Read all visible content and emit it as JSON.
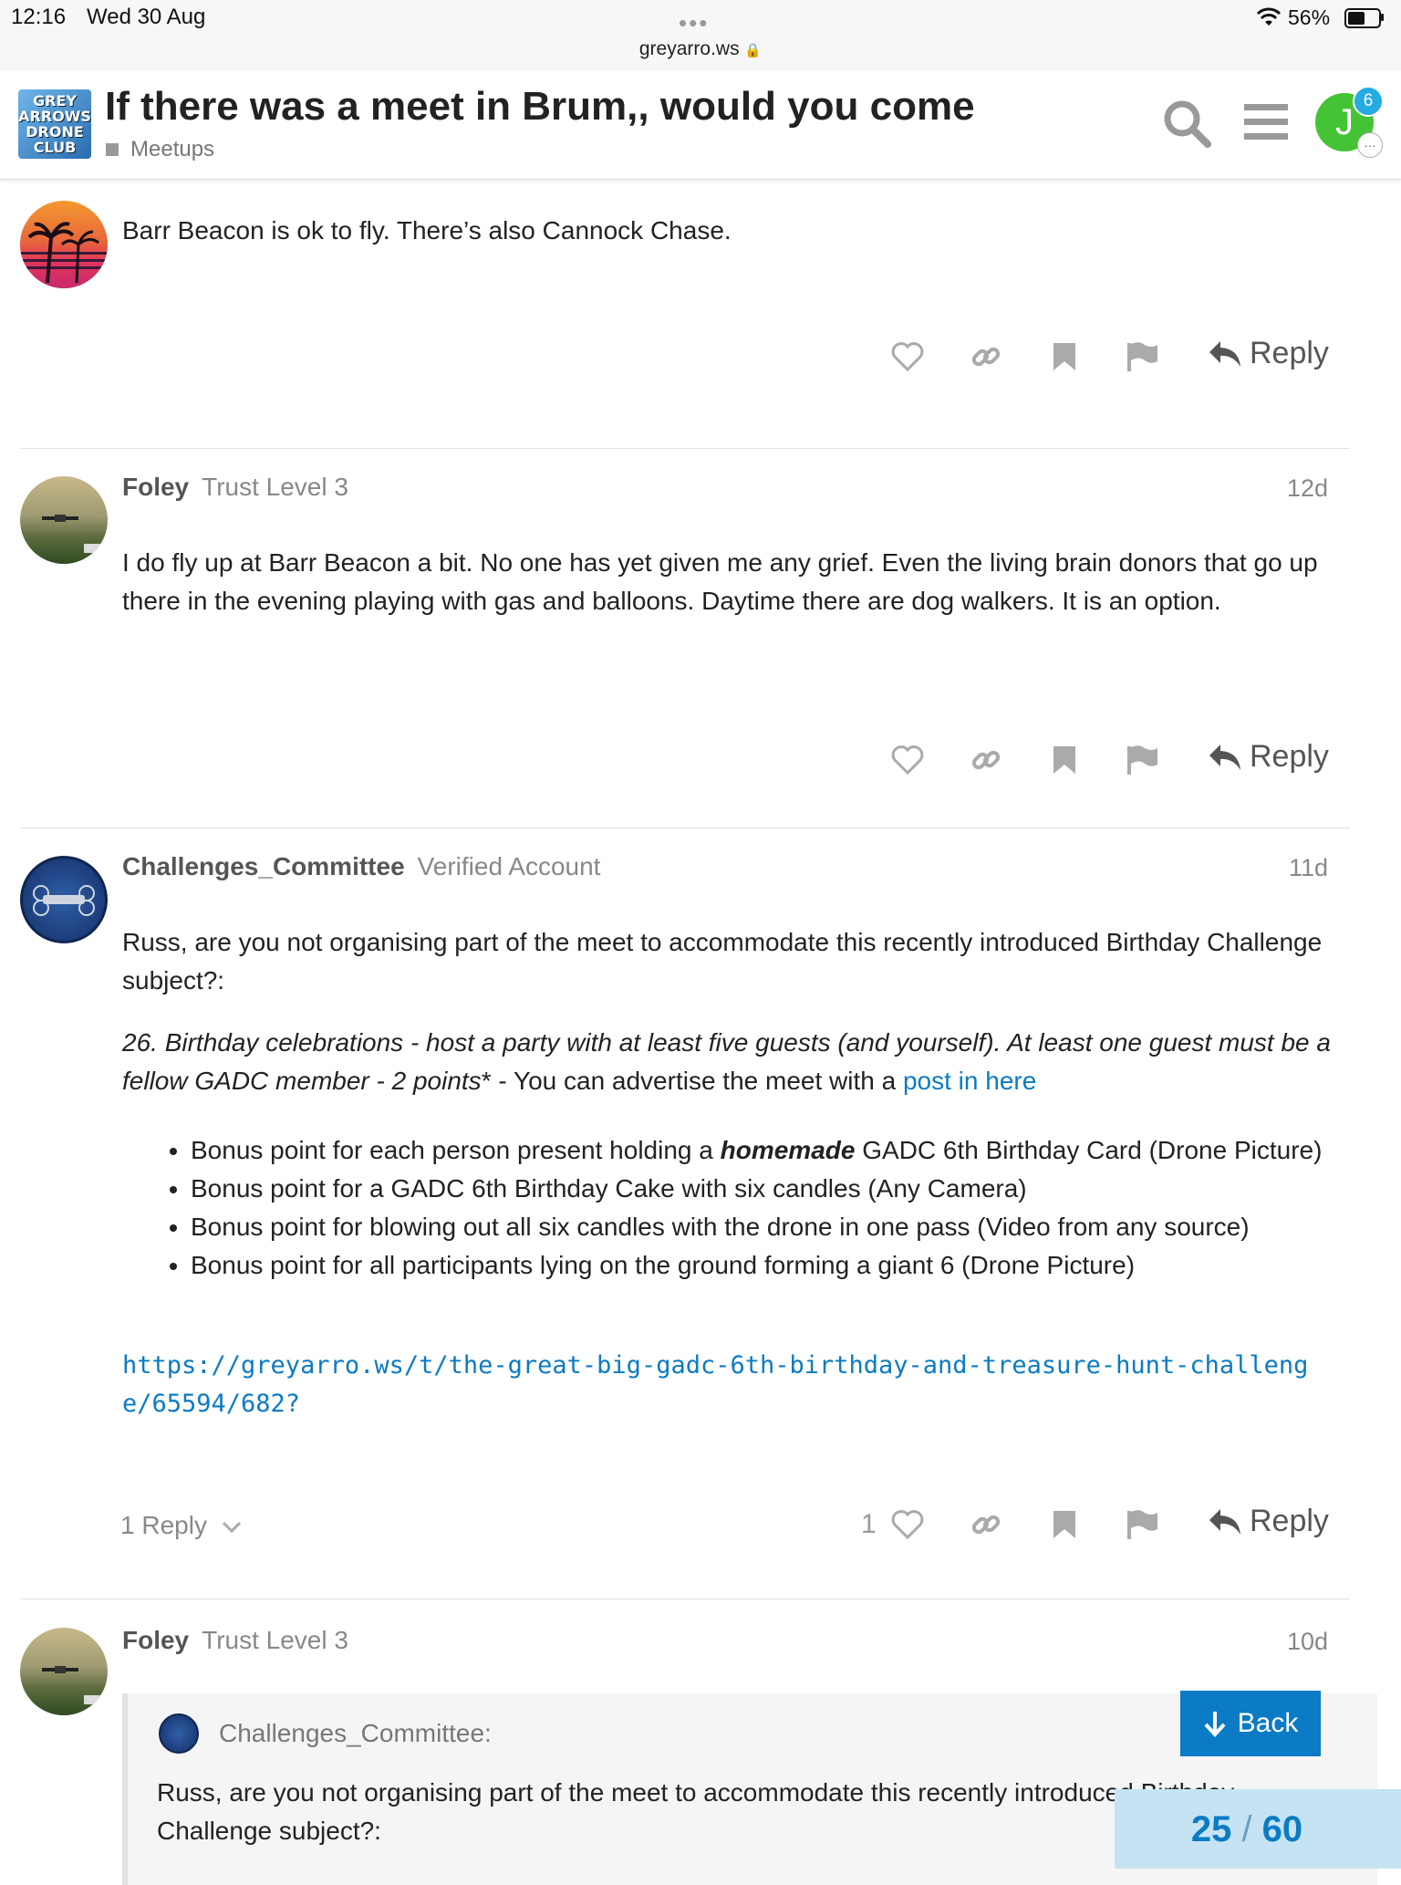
{
  "status_bar": {
    "time": "12:16",
    "date": "Wed 30 Aug",
    "url": "greyarro.ws",
    "battery": "56%"
  },
  "header": {
    "logo_text": [
      "GREY",
      "ARROWS",
      "DRONE",
      "CLUB"
    ],
    "title": "If there was a meet in Brum,, would you come",
    "category": "Meetups",
    "notification_count": "6",
    "avatar_letter": "J"
  },
  "posts": [
    {
      "text": "Barr Beacon is ok to fly. There’s also Cannock Chase.",
      "reply_label": "Reply"
    },
    {
      "username": "Foley",
      "user_title": "Trust Level 3",
      "date": "12d",
      "text": "I do fly up at Barr Beacon a bit. No one has yet given me any grief. Even the living brain donors that go up there in the evening playing with gas and balloons. Daytime there are dog walkers. It is an option.",
      "reply_label": "Reply"
    },
    {
      "username": "Challenges_Committee",
      "user_title": "Verified Account",
      "date": "11d",
      "intro": "Russ, are you not organising part of the meet to accommodate this recently introduced Birthday Challenge subject?:",
      "quote_italic": "26. Birthday celebrations - host a party with at least five guests (and yourself). At least one guest must be a fellow GADC member - 2 points",
      "quote_rest": "* - You can advertise the meet with a ",
      "quote_link": "post in here",
      "bullet1_pre": "Bonus point for each person present holding a ",
      "bullet1_bold": "homemade",
      "bullet1_post": " GADC 6th Birthday Card (Drone Picture)",
      "bullet2": "Bonus point for a GADC 6th Birthday Cake with six candles (Any Camera)",
      "bullet3": "Bonus point for blowing out all six candles with the drone in one pass (Video from any source)",
      "bullet4": "Bonus point for all participants lying on the ground forming a giant 6 (Drone Picture)",
      "url": "https://greyarro.ws/t/the-great-big-gadc-6th-birthday-and-treasure-hunt-challenge/65594/682?",
      "replies_label": "1 Reply",
      "like_count": "1",
      "reply_label": "Reply"
    },
    {
      "username": "Foley",
      "user_title": "Trust Level 3",
      "date": "10d",
      "quote_user": "Challenges_Committee:",
      "quote_text": "Russ, are you not organising part of the meet to accommodate this recently introduced Birthday Challenge subject?:"
    }
  ],
  "back_label": "Back",
  "progress": {
    "current": "25",
    "total": "60"
  }
}
